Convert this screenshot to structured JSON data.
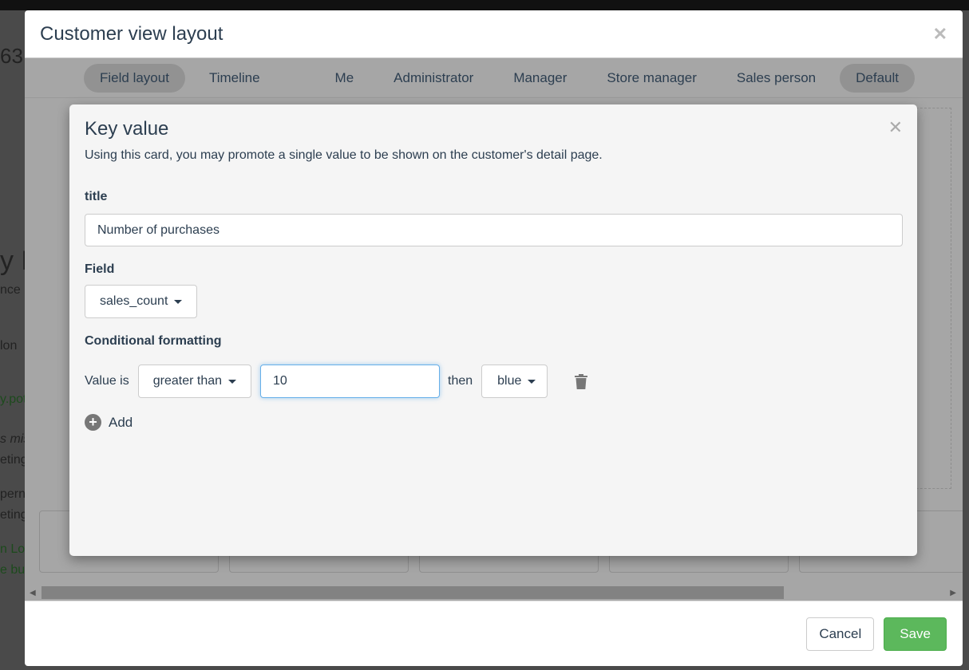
{
  "background": {
    "fragments": [
      "63",
      "y P",
      "nce",
      "lon",
      "y.pot",
      "s mis",
      "eting",
      "pern",
      "eting",
      "n Lo",
      "e bu"
    ]
  },
  "modal": {
    "title": "Customer view layout",
    "tabs": [
      {
        "label": "Field layout",
        "active": true
      },
      {
        "label": "Timeline",
        "active": false
      },
      {
        "label": "Me",
        "active": false
      },
      {
        "label": "Administrator",
        "active": false
      },
      {
        "label": "Manager",
        "active": false
      },
      {
        "label": "Store manager",
        "active": false
      },
      {
        "label": "Sales person",
        "active": false
      },
      {
        "label": "Default",
        "active": true
      }
    ],
    "cancel_label": "Cancel",
    "save_label": "Save",
    "save_color": "#5cb85c"
  },
  "dialog": {
    "title": "Key value",
    "description": "Using this card, you may promote a single value to be shown on the customer's detail page.",
    "title_label": "title",
    "title_value": "Number of purchases",
    "field_label": "Field",
    "field_value": "sales_count",
    "cf_label": "Conditional formatting",
    "rule": {
      "prefix": "Value is",
      "operator": "greater than",
      "value": "10",
      "then": "then",
      "color": "blue"
    },
    "add_label": "Add"
  }
}
